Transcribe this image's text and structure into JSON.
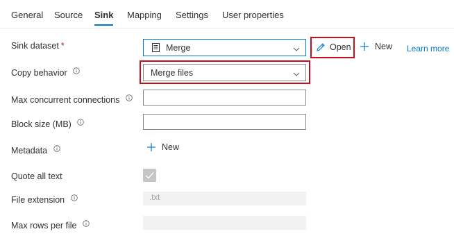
{
  "tabs": [
    {
      "label": "General"
    },
    {
      "label": "Source"
    },
    {
      "label": "Sink"
    },
    {
      "label": "Mapping"
    },
    {
      "label": "Settings"
    },
    {
      "label": "User properties"
    }
  ],
  "active_tab": "Sink",
  "fields": {
    "sink_dataset": {
      "label": "Sink dataset",
      "required_marker": "*",
      "value": "Merge"
    },
    "copy_behavior": {
      "label": "Copy behavior",
      "value": "Merge files"
    },
    "max_concurrent": {
      "label": "Max concurrent connections",
      "value": ""
    },
    "block_size": {
      "label": "Block size (MB)",
      "value": ""
    },
    "metadata": {
      "label": "Metadata"
    },
    "quote_all_text": {
      "label": "Quote all text",
      "checked": true,
      "disabled": true
    },
    "file_extension": {
      "label": "File extension",
      "placeholder": ".txt"
    },
    "max_rows": {
      "label": "Max rows per file",
      "value": ""
    }
  },
  "actions": {
    "open": "Open",
    "new": "New",
    "learn_more": "Learn more",
    "metadata_new": "New"
  },
  "colors": {
    "accent": "#0078d4",
    "highlight": "#c50f1f",
    "text": "#323130",
    "disabled_bg": "#f3f2f1"
  },
  "icons": {
    "dataset": "document-icon",
    "open": "pencil-icon",
    "new": "plus-icon",
    "learn_more": "external-link-icon",
    "dropdown": "chevron-down-icon",
    "info": "info-icon",
    "check": "checkmark-icon"
  }
}
